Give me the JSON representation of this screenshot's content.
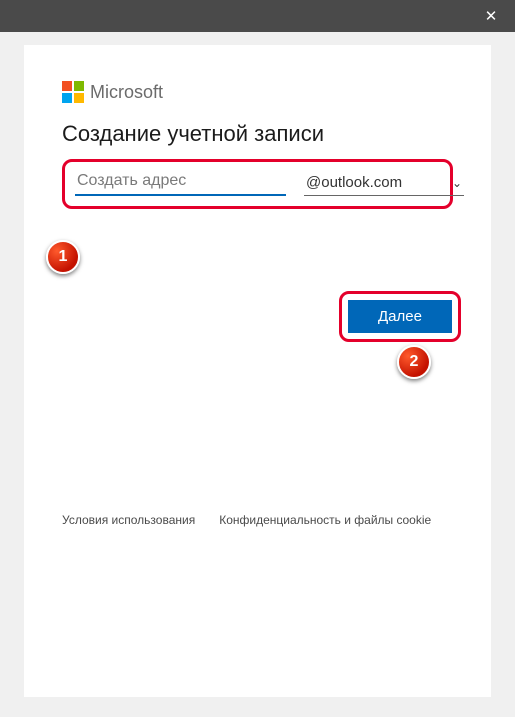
{
  "titlebar": {
    "close": "✕"
  },
  "brand": {
    "name": "Microsoft"
  },
  "heading": "Создание учетной записи",
  "email": {
    "placeholder": "Создать адрес",
    "domain": "@outlook.com"
  },
  "next_button": "Далее",
  "annotations": {
    "step1": "1",
    "step2": "2"
  },
  "footer": {
    "terms": "Условия использования",
    "privacy": "Конфиденциальность и файлы cookie"
  },
  "colors": {
    "primary": "#0067b8",
    "highlight": "#e4002b"
  }
}
